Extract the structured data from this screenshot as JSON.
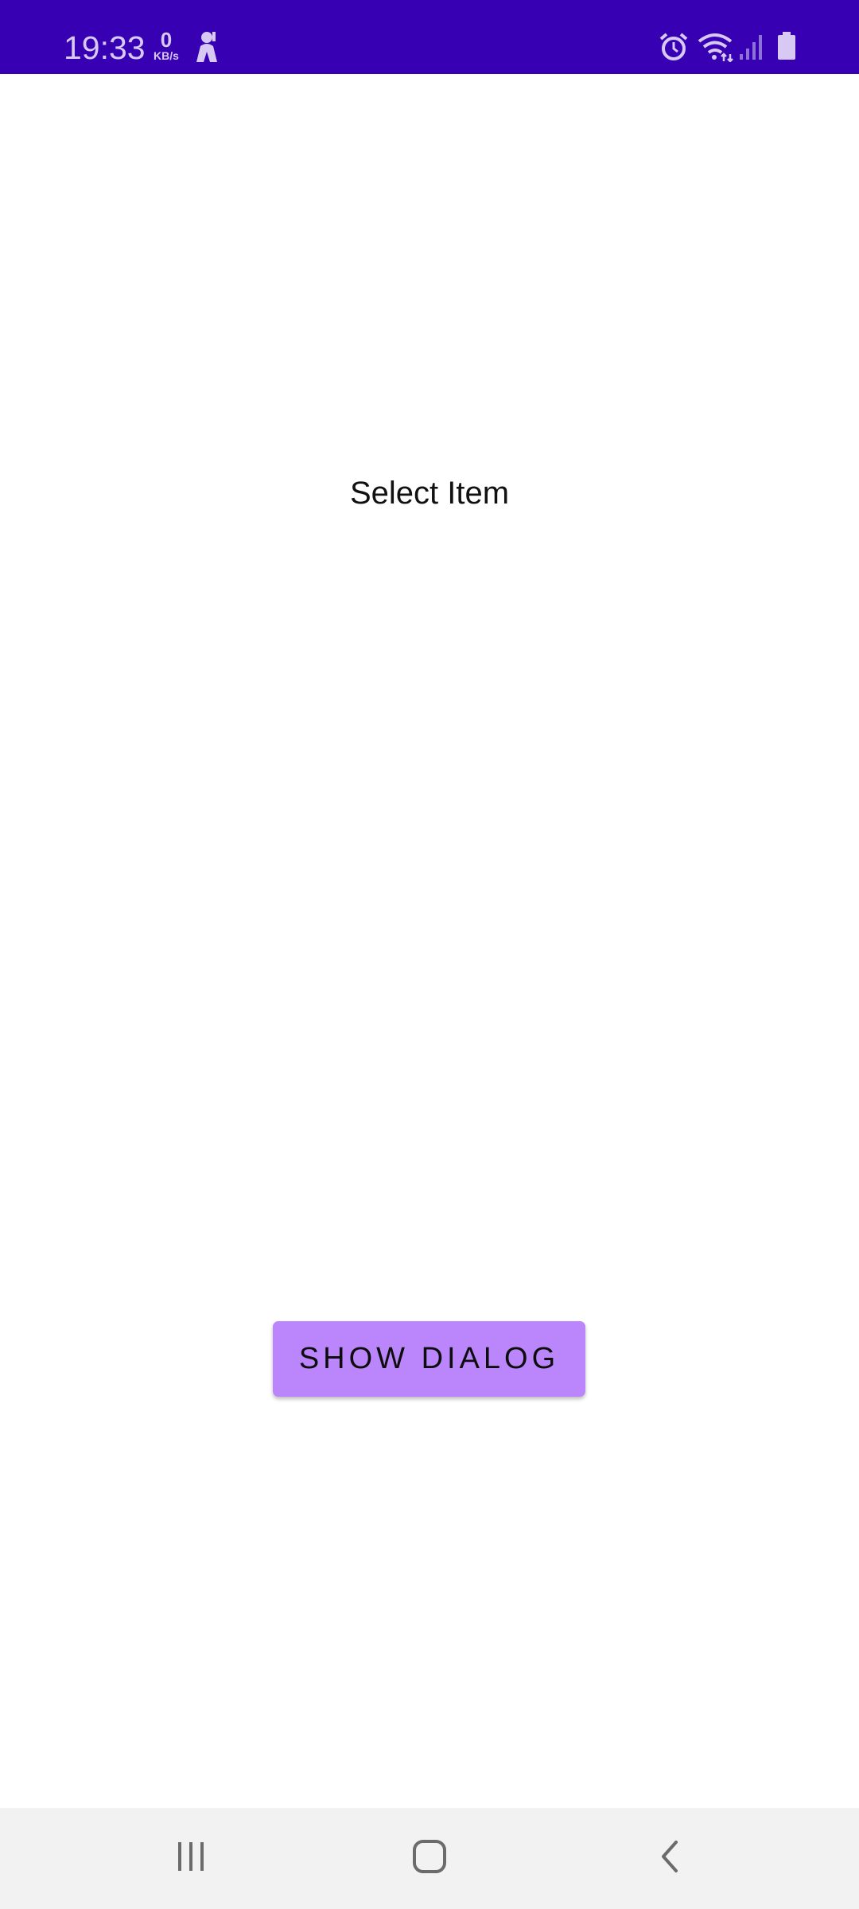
{
  "status_bar": {
    "time": "19:33",
    "net_speed_value": "0",
    "net_speed_unit": "KB/s",
    "icons": [
      "vpn-person-icon",
      "alarm-icon",
      "wifi-icon",
      "signal-icon",
      "battery-icon"
    ],
    "background_color": "#3700b3"
  },
  "main": {
    "title": "Select Item",
    "show_dialog_label": "SHOW DIALOG",
    "button_color": "#bb86fc"
  },
  "nav_bar": {
    "icons": [
      "recent-apps-icon",
      "home-icon",
      "back-icon"
    ]
  }
}
